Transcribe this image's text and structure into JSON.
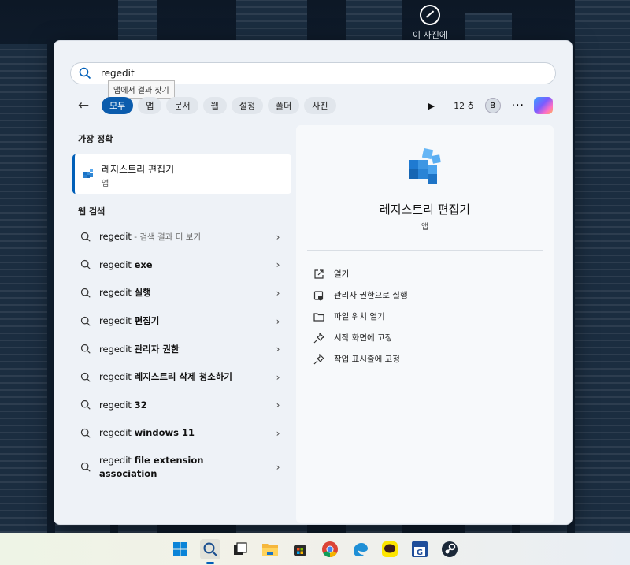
{
  "desktop": {
    "icon_label": "이 사진에"
  },
  "search": {
    "query": "regedit",
    "tooltip": "앱에서 결과 찾기"
  },
  "tabs": [
    {
      "label": "모두",
      "active": true
    },
    {
      "label": "앱"
    },
    {
      "label": "문서"
    },
    {
      "label": "웹"
    },
    {
      "label": "설정"
    },
    {
      "label": "폴더"
    },
    {
      "label": "사진"
    }
  ],
  "toolbar": {
    "count": "12",
    "account_initial": "B"
  },
  "best_match": {
    "section_title": "가장 정확",
    "name": "레지스트리 편집기",
    "type": "앱"
  },
  "web_search": {
    "section_title": "웹 검색",
    "items": [
      {
        "prefix": "regedit",
        "bold": "",
        "hint": " - 검색 결과 더 보기"
      },
      {
        "prefix": "regedit ",
        "bold": "exe",
        "hint": ""
      },
      {
        "prefix": "regedit ",
        "bold": "실행",
        "hint": ""
      },
      {
        "prefix": "regedit ",
        "bold": "편집기",
        "hint": ""
      },
      {
        "prefix": "regedit ",
        "bold": "관리자 권한",
        "hint": ""
      },
      {
        "prefix": "regedit ",
        "bold": "레지스트리 삭제 청소하기",
        "hint": ""
      },
      {
        "prefix": "regedit ",
        "bold": "32",
        "hint": ""
      },
      {
        "prefix": "regedit ",
        "bold": "windows 11",
        "hint": ""
      },
      {
        "prefix": "regedit ",
        "bold": "file extension association",
        "hint": ""
      }
    ]
  },
  "detail": {
    "name": "레지스트리 편집기",
    "type": "앱",
    "actions": [
      {
        "label": "열기",
        "icon": "open-external-icon"
      },
      {
        "label": "관리자 권한으로 실행",
        "icon": "run-as-admin-icon"
      },
      {
        "label": "파일 위치 열기",
        "icon": "folder-icon"
      },
      {
        "label": "시작 화면에 고정",
        "icon": "pin-icon"
      },
      {
        "label": "작업 표시줄에 고정",
        "icon": "pin-icon"
      }
    ]
  },
  "taskbar": {
    "apps": [
      "windows-start-icon",
      "search-icon",
      "task-view-icon",
      "file-explorer-icon",
      "store-icon",
      "chrome-icon",
      "edge-browser-icon",
      "kakaotalk-icon",
      "app-g-icon",
      "steam-icon"
    ]
  },
  "colors": {
    "accent": "#005fb8",
    "active_tab": "#0b5cad",
    "panel_bg": "#eef2f7"
  }
}
